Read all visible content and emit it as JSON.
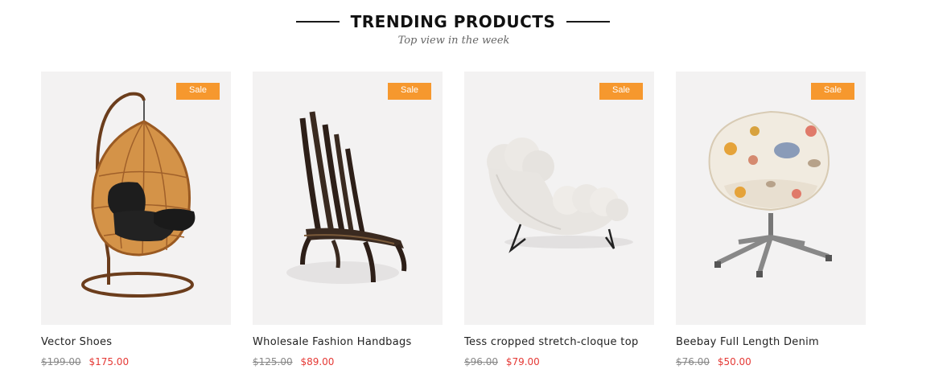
{
  "section": {
    "title": "TRENDING PRODUCTS",
    "subtitle": "Top view in the week"
  },
  "colors": {
    "sale_badge": "#f6982e",
    "new_price": "#e53935",
    "old_price": "#888888",
    "image_bg": "#f3f2f2"
  },
  "products": [
    {
      "name": "Vector Shoes",
      "badge": "Sale",
      "old_price": "$199.00",
      "new_price": "$175.00",
      "image_icon": "hanging-egg-chair-image"
    },
    {
      "name": "Wholesale Fashion Handbags",
      "badge": "Sale",
      "old_price": "$125.00",
      "new_price": "$89.00",
      "image_icon": "bentwood-chair-image"
    },
    {
      "name": "Tess cropped stretch-cloque top",
      "badge": "Sale",
      "old_price": "$96.00",
      "new_price": "$79.00",
      "image_icon": "cloud-lounge-chair-image"
    },
    {
      "name": "Beebay Full Length Denim",
      "badge": "Sale",
      "old_price": "$76.00",
      "new_price": "$50.00",
      "image_icon": "swivel-tub-chair-image"
    }
  ]
}
